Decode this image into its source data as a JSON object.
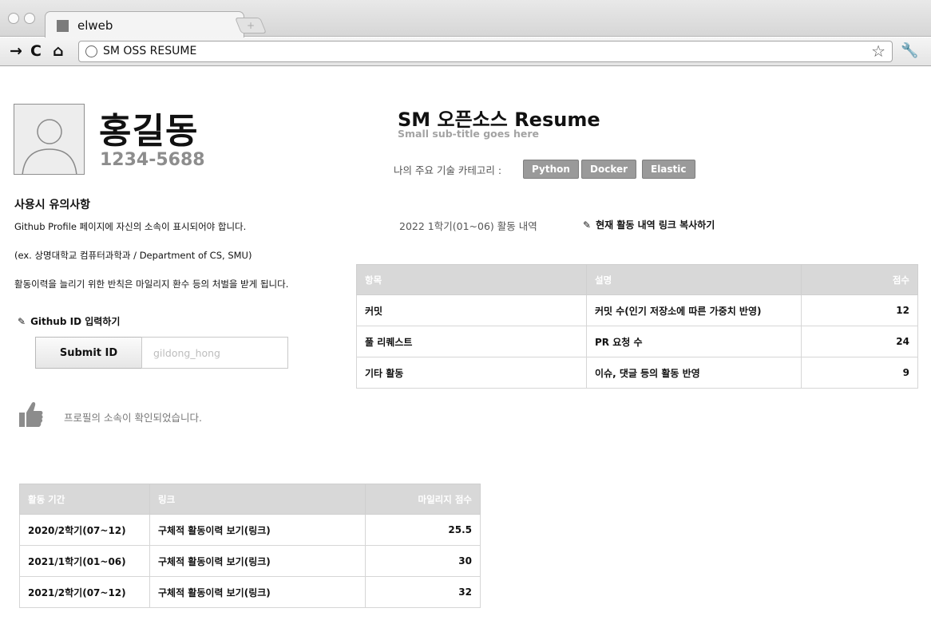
{
  "browser": {
    "tab_title": "elweb",
    "new_tab_label": "+",
    "url": "SM OSS RESUME",
    "icons": {
      "back": "arrow-right-icon",
      "reload": "reload-icon",
      "home": "home-icon",
      "bookmark": "star-icon",
      "settings": "wrench-icon"
    }
  },
  "profile": {
    "name": "홍길동",
    "phone": "1234-5688"
  },
  "notice": {
    "heading": "사용시 유의사항",
    "line1": "Github Profile 페이지에 자신의 소속이 표시되어야 합니다.",
    "line2": "(ex. 상명대학교 컴퓨터과학과 / Department of CS, SMU)",
    "line3": "활동이력을 늘리기 위한 반칙은 마일리지 환수 등의 처벌을 받게 됩니다."
  },
  "github": {
    "heading": "Github ID 입력하기",
    "submit_label": "Submit ID",
    "input_placeholder": "gildong_hong",
    "confirm_text": "프로필의 소속이 확인되었습니다."
  },
  "resume": {
    "title": "SM 오픈소스 Resume",
    "subtitle": "Small sub-title goes here",
    "skills_label": "나의 주요 기술 카테고리 :",
    "skills": [
      "Python",
      "Docker",
      "Elastic"
    ],
    "period_label": "2022 1학기(01~06) 활동 내역",
    "copy_link_label": "현재 활동 내역 링크 복사하기"
  },
  "score_table": {
    "headers": [
      "항목",
      "설명",
      "점수"
    ],
    "rows": [
      [
        "커밋",
        "커밋 수(인기 저장소에 따른 가중치 반영)",
        "12"
      ],
      [
        "풀 리퀘스트",
        "PR 요청 수",
        "24"
      ],
      [
        "기타 활동",
        "이슈, 댓글 등의 활동 반영",
        "9"
      ]
    ]
  },
  "history_table": {
    "headers": [
      "활동 기간",
      "링크",
      "마일리지 점수"
    ],
    "rows": [
      [
        "2020/2학기(07~12)",
        "구체적 활동이력 보기(링크)",
        "25.5"
      ],
      [
        "2021/1학기(01~06)",
        "구체적 활동이력 보기(링크)",
        "30"
      ],
      [
        "2021/2학기(07~12)",
        "구체적 활동이력 보기(링크)",
        "32"
      ]
    ]
  }
}
